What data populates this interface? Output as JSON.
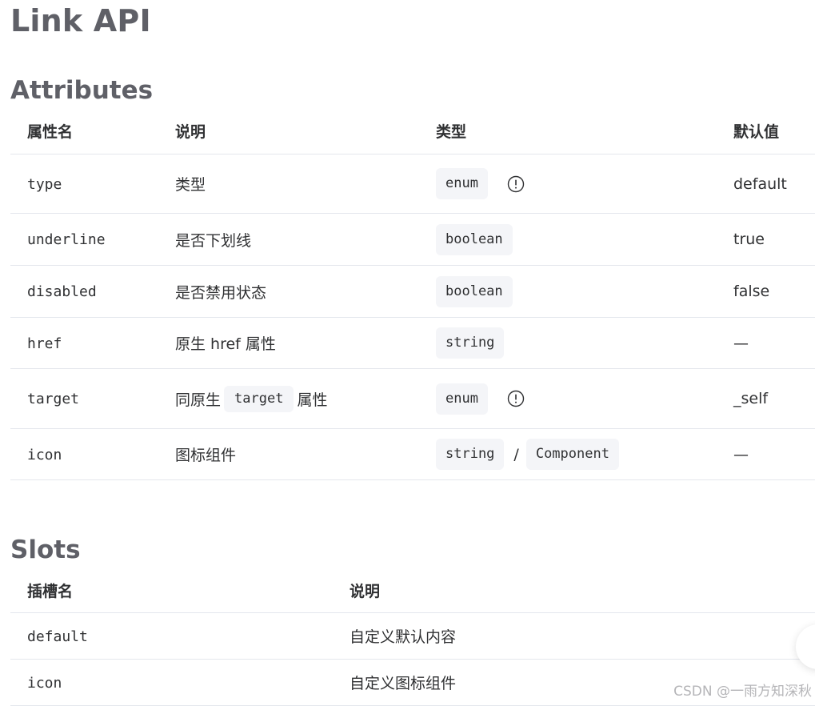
{
  "page": {
    "title": "Link API"
  },
  "attributes": {
    "heading": "Attributes",
    "columns": [
      "属性名",
      "说明",
      "类型",
      "默认值"
    ],
    "rows": [
      {
        "name": "type",
        "desc": "类型",
        "types": [
          "enum"
        ],
        "info": true,
        "default": "default"
      },
      {
        "name": "underline",
        "desc": "是否下划线",
        "types": [
          "boolean"
        ],
        "info": false,
        "default": "true"
      },
      {
        "name": "disabled",
        "desc": "是否禁用状态",
        "types": [
          "boolean"
        ],
        "info": false,
        "default": "false"
      },
      {
        "name": "href",
        "desc": "原生 href 属性",
        "types": [
          "string"
        ],
        "info": false,
        "default": "—"
      },
      {
        "name": "target",
        "desc_before": "同原生",
        "desc_code": "target",
        "desc_after": "属性",
        "types": [
          "enum"
        ],
        "info": true,
        "default": "_self"
      },
      {
        "name": "icon",
        "desc": "图标组件",
        "types": [
          "string",
          "Component"
        ],
        "type_separator": "/",
        "info": false,
        "default": "—"
      }
    ]
  },
  "slots": {
    "heading": "Slots",
    "columns": [
      "插槽名",
      "说明"
    ],
    "rows": [
      {
        "name": "default",
        "desc": "自定义默认内容"
      },
      {
        "name": "icon",
        "desc": "自定义图标组件"
      }
    ]
  },
  "watermark": "CSDN @一雨方知深秋",
  "icons": {
    "type_info": "info-circle-icon"
  },
  "colors": {
    "heading": "#5f6067",
    "text": "#303133",
    "border": "#e4e7ed",
    "code_bg": "#f4f5f8",
    "watermark": "#b5b5b8"
  }
}
